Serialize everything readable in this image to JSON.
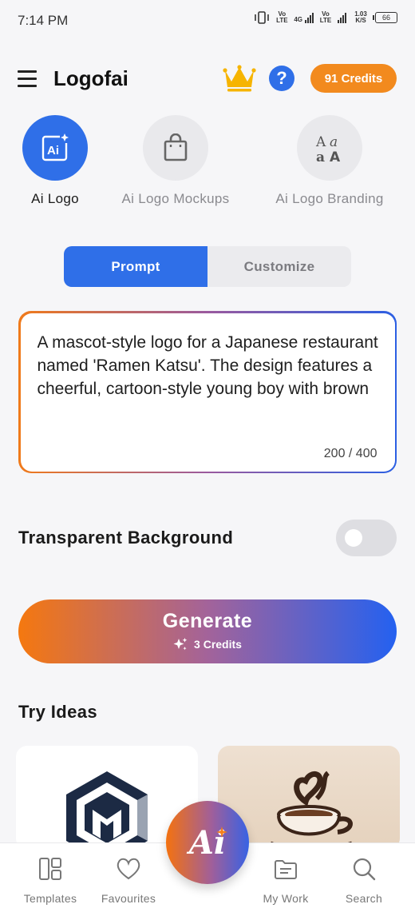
{
  "status_bar": {
    "time": "7:14 PM",
    "net1": "Vo LTE",
    "net2": "4G",
    "net3": "Vo LTE",
    "speed": "1.03 K/S",
    "battery": "66"
  },
  "header": {
    "title": "Logofai",
    "crown_icon": "crown-icon",
    "help_label": "?",
    "credits_label": "91 Credits",
    "colors": {
      "accent_blue": "#2f6fe8",
      "credits_orange": "#f28a1e"
    }
  },
  "modes": [
    {
      "label": "Ai Logo",
      "icon": "ai-logo-icon",
      "active": true
    },
    {
      "label": "Ai Logo Mockups",
      "icon": "shopping-bag-icon",
      "active": false
    },
    {
      "label": "Ai Logo Branding",
      "icon": "typography-icon",
      "active": false
    }
  ],
  "tabs": {
    "prompt": "Prompt",
    "customize": "Customize",
    "active": "prompt"
  },
  "prompt": {
    "text": "A mascot-style logo for a Japanese restaurant named 'Ramen Katsu'. The design features a cheerful, cartoon-style young boy with brown",
    "counter": "200 / 400"
  },
  "transparent_background": {
    "label": "Transparent Background",
    "enabled": false
  },
  "generate": {
    "label": "Generate",
    "credits": "3 Credits",
    "icon": "sparkle-icon"
  },
  "ideas": {
    "title": "Try Ideas",
    "cards": [
      {
        "icon": "hexagon-monogram-logo"
      },
      {
        "icon": "coffee-cup-logo"
      }
    ]
  },
  "bottom_nav": {
    "items": [
      {
        "label": "Templates",
        "icon": "templates-icon"
      },
      {
        "label": "Favourites",
        "icon": "heart-icon"
      },
      {
        "label": "My Work",
        "icon": "folder-icon"
      },
      {
        "label": "Search",
        "icon": "search-icon"
      }
    ],
    "fab_label": "Ai"
  }
}
